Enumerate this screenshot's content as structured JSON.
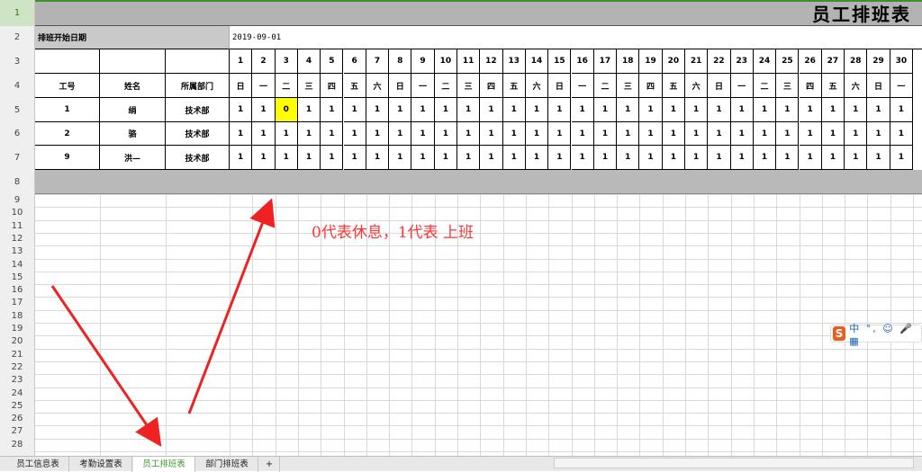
{
  "sheet": {
    "title": "员工排班表",
    "start_label": "排班开始日期",
    "start_date": "2019-09-01",
    "col_headers": [
      "工号",
      "姓名",
      "所属部门"
    ],
    "days": [
      "1",
      "2",
      "3",
      "4",
      "5",
      "6",
      "7",
      "8",
      "9",
      "10",
      "11",
      "12",
      "13",
      "14",
      "15",
      "16",
      "17",
      "18",
      "19",
      "20",
      "21",
      "22",
      "23",
      "24",
      "25",
      "26",
      "27",
      "28",
      "29",
      "30"
    ],
    "weekdays": [
      "日",
      "一",
      "二",
      "三",
      "四",
      "五",
      "六",
      "日",
      "一",
      "二",
      "三",
      "四",
      "五",
      "六",
      "日",
      "一",
      "二",
      "三",
      "四",
      "五",
      "六",
      "日",
      "一",
      "二",
      "三",
      "四",
      "五",
      "六",
      "日",
      "一"
    ],
    "employees": [
      {
        "id": "1",
        "name": "绢",
        "dept": "技术部",
        "schedule": [
          "1",
          "1",
          "0",
          "1",
          "1",
          "1",
          "1",
          "1",
          "1",
          "1",
          "1",
          "1",
          "1",
          "1",
          "1",
          "1",
          "1",
          "1",
          "1",
          "1",
          "1",
          "1",
          "1",
          "1",
          "1",
          "1",
          "1",
          "1",
          "1",
          "1"
        ]
      },
      {
        "id": "2",
        "name": "骆",
        "dept": "技术部",
        "schedule": [
          "1",
          "1",
          "1",
          "1",
          "1",
          "1",
          "1",
          "1",
          "1",
          "1",
          "1",
          "1",
          "1",
          "1",
          "1",
          "1",
          "1",
          "1",
          "1",
          "1",
          "1",
          "1",
          "1",
          "1",
          "1",
          "1",
          "1",
          "1",
          "1",
          "1"
        ]
      },
      {
        "id": "9",
        "name": "洪—",
        "dept": "技术部",
        "schedule": [
          "1",
          "1",
          "1",
          "1",
          "1",
          "1",
          "1",
          "1",
          "1",
          "1",
          "1",
          "1",
          "1",
          "1",
          "1",
          "1",
          "1",
          "1",
          "1",
          "1",
          "1",
          "1",
          "1",
          "1",
          "1",
          "1",
          "1",
          "1",
          "1",
          "1"
        ]
      }
    ],
    "highlight_color": "#ffff00"
  },
  "row_numbers": [
    "1",
    "2",
    "3",
    "4",
    "5",
    "6",
    "7",
    "8",
    "9",
    "10",
    "11",
    "12",
    "13",
    "14",
    "15",
    "16",
    "17",
    "18",
    "19",
    "20",
    "21",
    "22",
    "23",
    "24",
    "25",
    "26",
    "27",
    "28"
  ],
  "annotation": "0代表休息，1代表  上班",
  "tabs": [
    "员工信息表",
    "考勤设置表",
    "员工排班表",
    "部门排班表",
    "+"
  ],
  "active_tab": "员工排班表",
  "ime": {
    "logo": "S",
    "text": "中 °, ☺ 🎤 ▦"
  }
}
